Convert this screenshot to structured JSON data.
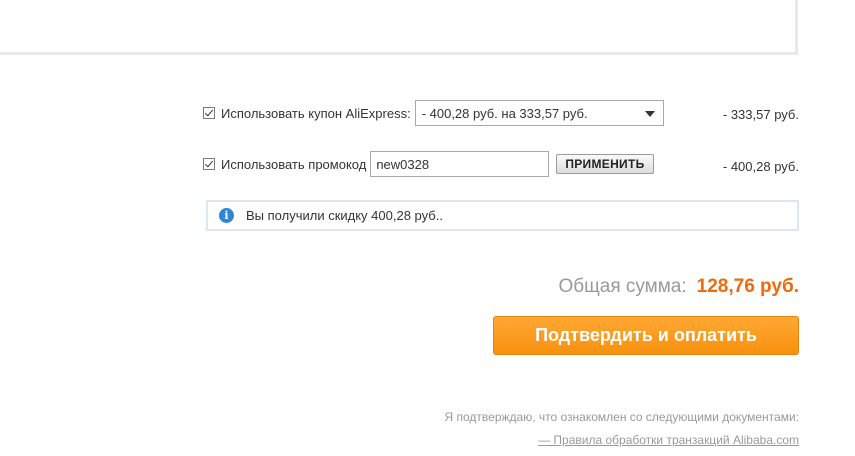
{
  "coupon": {
    "label": "Использовать купон AliExpress:",
    "selected": "- 400,28 руб. на 333,57 руб.",
    "amount": "- 333,57 руб.",
    "checked": true
  },
  "promo": {
    "label": "Использовать промокод",
    "value": "new0328",
    "apply_label": "ПРИМЕНИТЬ",
    "amount": "- 400,28 руб.",
    "checked": true
  },
  "info": {
    "icon": "info-icon",
    "message": "Вы получили скидку 400,28 руб.."
  },
  "total": {
    "label": "Общая сумма:",
    "value": "128,76 руб."
  },
  "pay_button": {
    "label": "Подтвердить и оплатить"
  },
  "footer": {
    "disclaimer": "Я подтверждаю, что ознакомлен со следующими документами:",
    "rules_link": "— Правила обработки транзакций Alibaba.com"
  },
  "colors": {
    "accent_orange": "#f2680a",
    "button_orange": "#f7910f",
    "info_blue": "#2f86d6"
  }
}
